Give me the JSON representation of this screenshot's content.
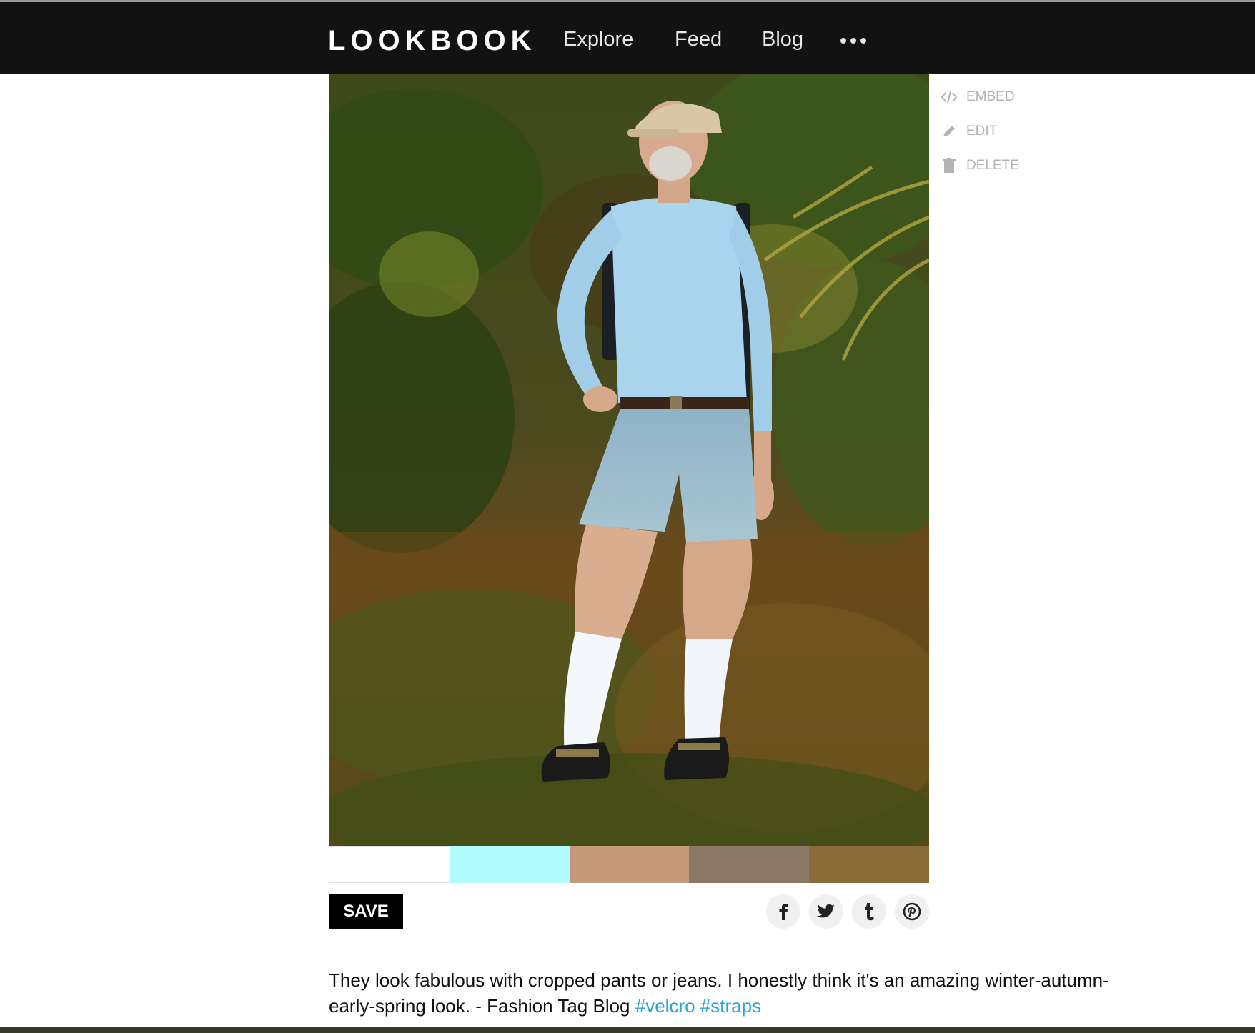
{
  "nav": {
    "logo": "LOOKBOOK",
    "links": [
      "Explore",
      "Feed",
      "Blog"
    ],
    "more_icon": "ellipsis-icon"
  },
  "photo": {
    "subject": "outdoor-look-photo"
  },
  "palette": {
    "colors": [
      "#ffffff",
      "#b0fcfe",
      "#c4997b",
      "#8b7865",
      "#8b6c38"
    ]
  },
  "actions": [
    {
      "label": "EMBED",
      "icon": "code-icon"
    },
    {
      "label": "EDIT",
      "icon": "pencil-icon"
    },
    {
      "label": "DELETE",
      "icon": "trash-icon"
    }
  ],
  "save_label": "SAVE",
  "share": [
    "facebook-icon",
    "twitter-icon",
    "tumblr-icon",
    "pinterest-icon"
  ],
  "caption": {
    "text": "They look fabulous with cropped pants or jeans. I honestly think it's an amazing winter-autumn-early-spring look. - Fashion Tag Blog",
    "tags": [
      "#velcro",
      "#straps"
    ]
  },
  "colors": {
    "nav_bg": "#121212",
    "tag": "#2aa3dc",
    "action_text": "#b3b3b3"
  }
}
